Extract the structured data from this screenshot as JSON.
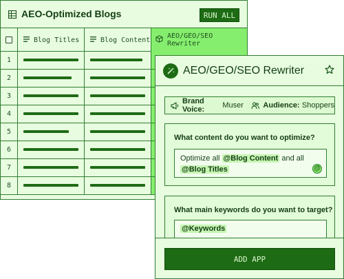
{
  "table": {
    "title": "AEO-Optimized Blogs",
    "run_label": "RUN ALL",
    "columns": {
      "titles": "Blog Titles",
      "content": "Blog Content",
      "rewriter": "AEO/GEO/SEO Rewriter"
    },
    "row_numbers": [
      "1",
      "2",
      "3",
      "4",
      "5",
      "6",
      "7",
      "8"
    ]
  },
  "app": {
    "title": "AEO/GEO/SEO Rewriter",
    "brand_voice_label": "Brand Voice:",
    "brand_voice_value": "Muser",
    "audience_label": "Audience:",
    "audience_value": "Shoppers",
    "question1": {
      "label": "What content do you want to optimize?",
      "text_prefix": "Optimize all",
      "tag1": "@Blog Content",
      "text_mid": "and all",
      "tag2": "@Blog Titles",
      "at_symbol": "@"
    },
    "question2": {
      "label": "What main keywords do you want to target?",
      "tag": "@Keywords"
    },
    "add_label": "ADD APP"
  },
  "colors": {
    "accent": "#1d6b14",
    "panel_bg": "#e8fce0",
    "highlight_column": "#86ee6e",
    "border": "#2f7d2f"
  },
  "icons": [
    "grid-icon",
    "checkbox-icon",
    "lines-icon",
    "cube-icon",
    "wand-icon",
    "star-icon",
    "megaphone-icon",
    "users-icon",
    "at-icon"
  ]
}
